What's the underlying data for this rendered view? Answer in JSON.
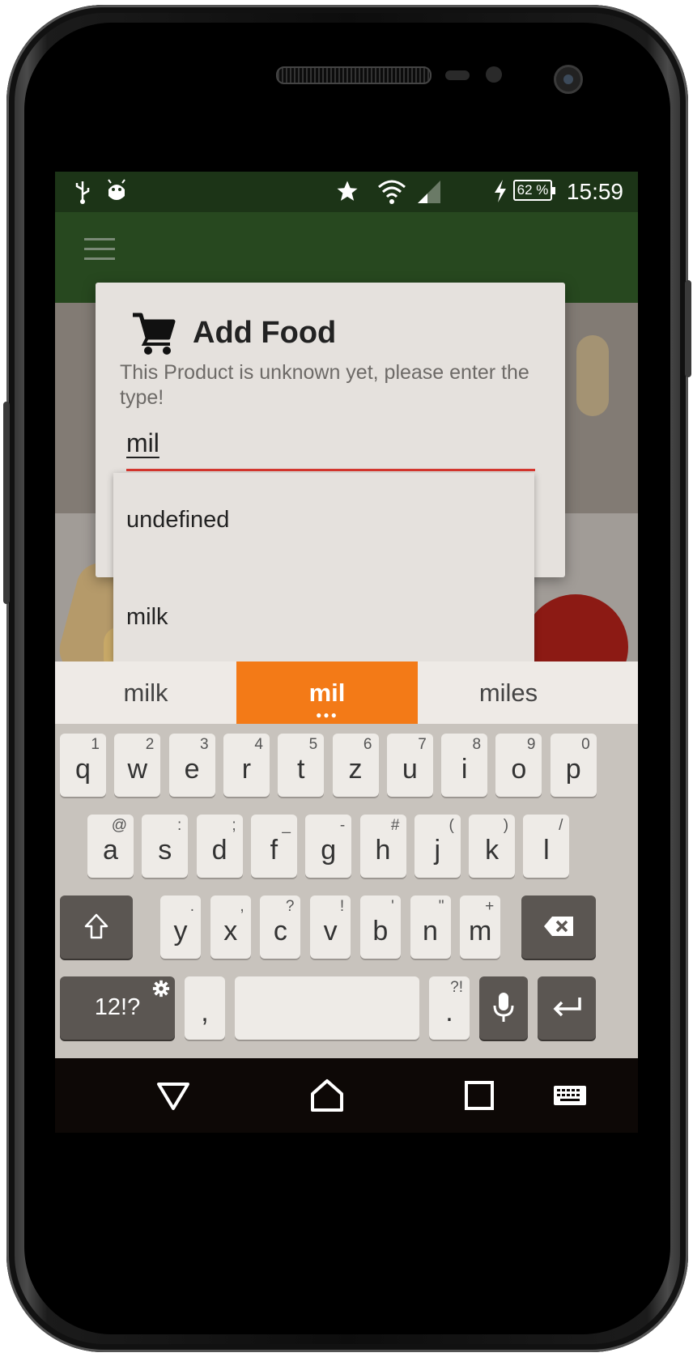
{
  "status_bar": {
    "battery_percent": "62 %",
    "time": "15:59"
  },
  "dialog": {
    "title": "Add Food",
    "message": "This Product is unknown yet, please enter the type!",
    "input_value": "mil"
  },
  "autocomplete": {
    "items": [
      "undefined",
      "milk"
    ]
  },
  "keyboard": {
    "suggestions": [
      "milk",
      "mil",
      "miles"
    ],
    "active_suggestion": "mil",
    "row1": [
      {
        "key": "q",
        "hint": "1"
      },
      {
        "key": "w",
        "hint": "2"
      },
      {
        "key": "e",
        "hint": "3"
      },
      {
        "key": "r",
        "hint": "4"
      },
      {
        "key": "t",
        "hint": "5"
      },
      {
        "key": "z",
        "hint": "6"
      },
      {
        "key": "u",
        "hint": "7"
      },
      {
        "key": "i",
        "hint": "8"
      },
      {
        "key": "o",
        "hint": "9"
      },
      {
        "key": "p",
        "hint": "0"
      }
    ],
    "row2": [
      {
        "key": "a",
        "hint": "@"
      },
      {
        "key": "s",
        "hint": ":"
      },
      {
        "key": "d",
        "hint": ";"
      },
      {
        "key": "f",
        "hint": "_"
      },
      {
        "key": "g",
        "hint": "-"
      },
      {
        "key": "h",
        "hint": "#"
      },
      {
        "key": "j",
        "hint": "("
      },
      {
        "key": "k",
        "hint": ")"
      },
      {
        "key": "l",
        "hint": "/"
      }
    ],
    "row3": [
      {
        "key": "y",
        "hint": "."
      },
      {
        "key": "x",
        "hint": ","
      },
      {
        "key": "c",
        "hint": "?"
      },
      {
        "key": "v",
        "hint": "!"
      },
      {
        "key": "b",
        "hint": "'"
      },
      {
        "key": "n",
        "hint": "\""
      },
      {
        "key": "m",
        "hint": "+"
      }
    ],
    "symbols_key": "12!?",
    "comma_key": ",",
    "period_key": ".",
    "period_hint": "?!"
  },
  "colors": {
    "status_bar": "#1c3417",
    "toolbar": "#27481f",
    "input_underline": "#d9372f",
    "active_suggestion": "#f37a17"
  }
}
